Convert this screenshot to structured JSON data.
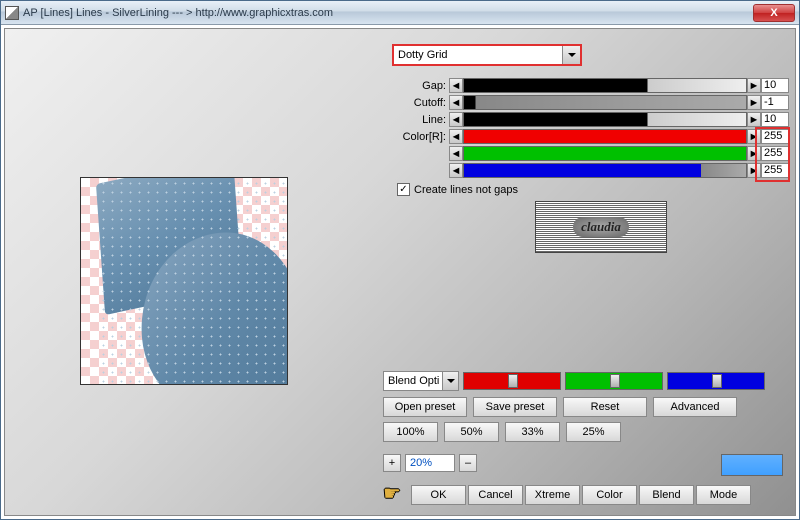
{
  "window": {
    "title": "AP [Lines]  Lines - SilverLining    --- >  http://www.graphicxtras.com"
  },
  "dropdown": {
    "selected": "Dotty Grid"
  },
  "params": {
    "gap": {
      "label": "Gap:",
      "value": "10"
    },
    "cutoff": {
      "label": "Cutoff:",
      "value": "-1"
    },
    "line": {
      "label": "Line:",
      "value": "10"
    },
    "r": {
      "label": "Color[R]:",
      "value": "255"
    },
    "g": {
      "label": "",
      "value": "255"
    },
    "b": {
      "label": "",
      "value": "255"
    }
  },
  "checkbox": {
    "label": "Create lines not gaps",
    "checked": true
  },
  "logo_text": "claudia",
  "blend": {
    "label": "Blend Opti"
  },
  "buttons": {
    "open_preset": "Open preset",
    "save_preset": "Save preset",
    "reset": "Reset",
    "advanced": "Advanced",
    "p100": "100%",
    "p50": "50%",
    "p33": "33%",
    "p25": "25%",
    "zoom_plus": "+",
    "zoom_minus": "–",
    "zoom_value": "20%",
    "ok": "OK",
    "cancel": "Cancel",
    "xtreme": "Xtreme",
    "color": "Color",
    "blend": "Blend",
    "mode": "Mode"
  },
  "arrows": {
    "left": "◄",
    "right": "►"
  },
  "close_x": "X"
}
